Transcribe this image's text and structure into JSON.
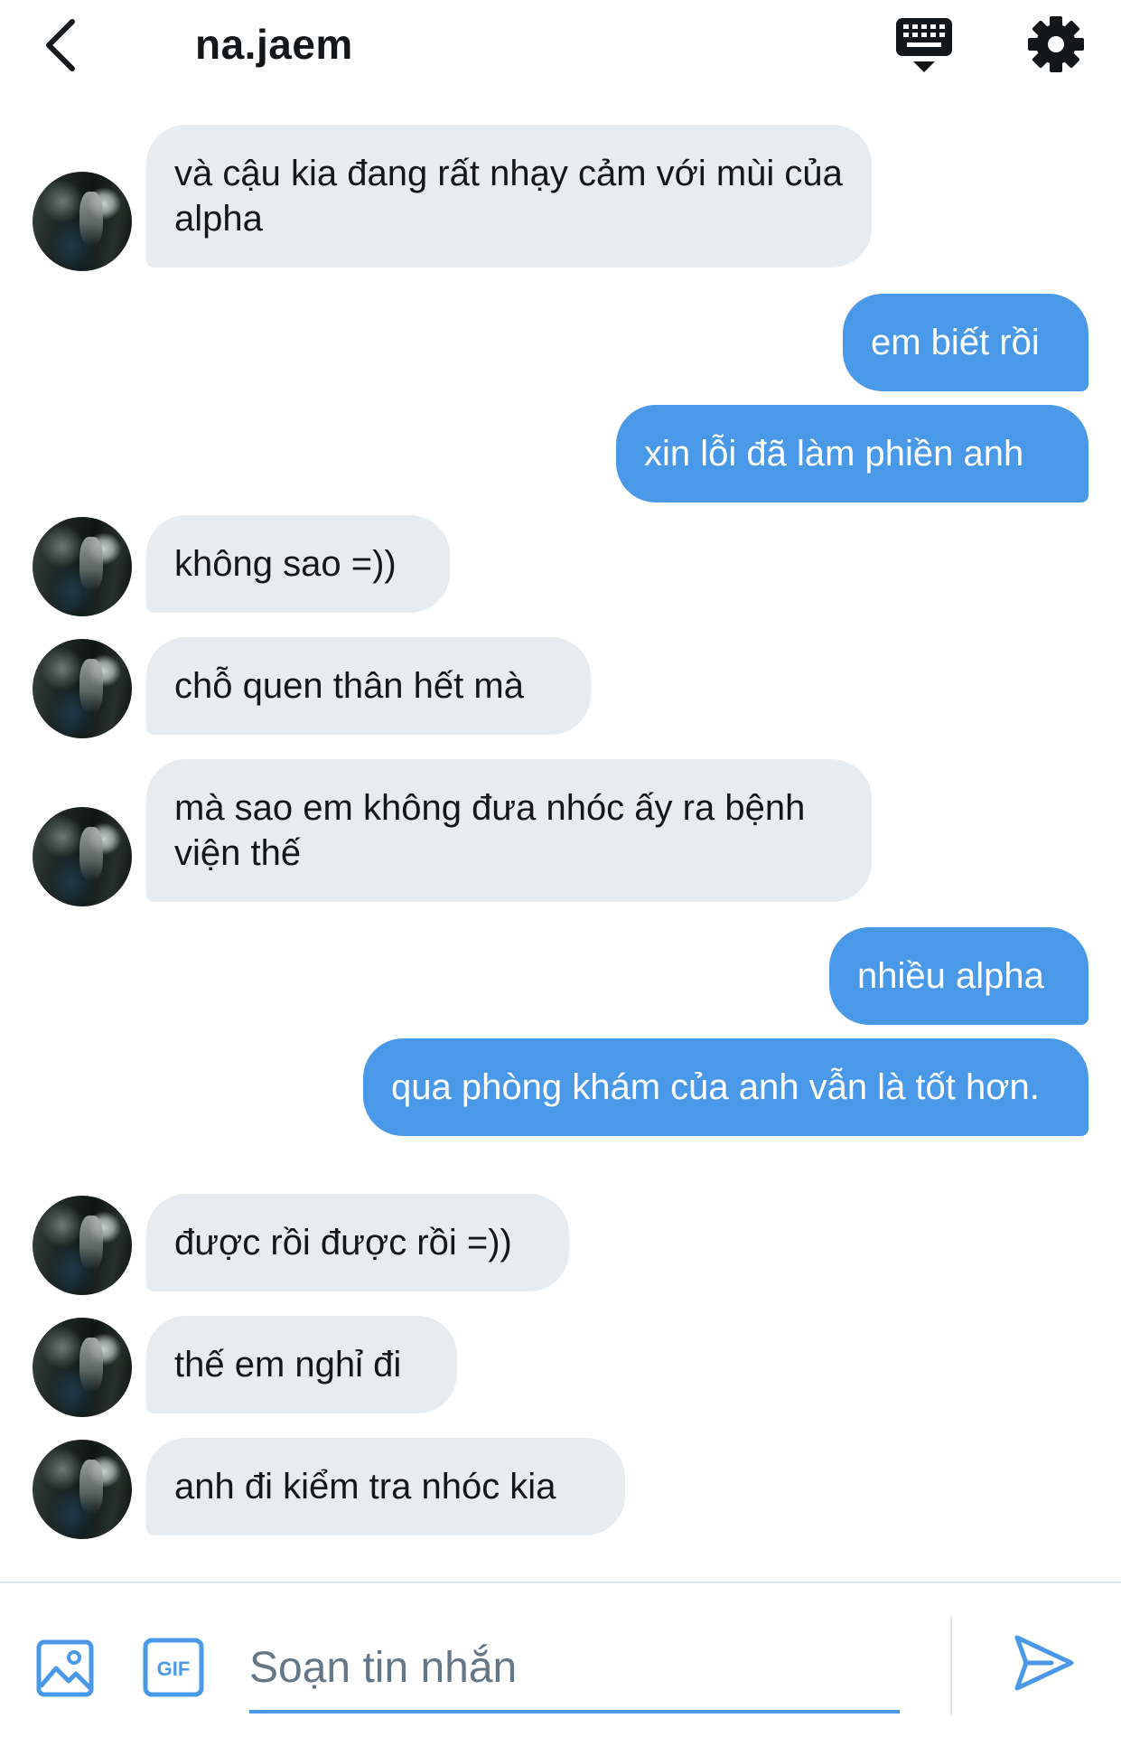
{
  "header": {
    "title": "na.jaem",
    "back_icon": "chevron-left-icon",
    "keyboard_icon": "keyboard-hide-icon",
    "settings_icon": "gear-icon"
  },
  "messages": [
    {
      "direction": "in",
      "text": "và cậu kia đang rất nhạy cảm với mùi của alpha"
    },
    {
      "direction": "out",
      "text": "em biết rồi"
    },
    {
      "direction": "out",
      "text": "xin lỗi đã làm phiền anh"
    },
    {
      "direction": "in",
      "text": "không sao =))"
    },
    {
      "direction": "in",
      "text": "chỗ quen thân hết mà"
    },
    {
      "direction": "in",
      "text": "mà sao em không đưa nhóc ấy ra bệnh viện thế"
    },
    {
      "direction": "out",
      "text": "nhiều alpha"
    },
    {
      "direction": "out",
      "text": "qua phòng khám của anh vẫn là tốt hơn."
    },
    {
      "direction": "in",
      "text": "được rồi được rồi =))"
    },
    {
      "direction": "in",
      "text": "thế em nghỉ đi"
    },
    {
      "direction": "in",
      "text": "anh đi kiểm tra nhóc kia"
    }
  ],
  "composer": {
    "placeholder": "Soạn tin nhắn",
    "value": "",
    "gif_label": "GIF",
    "image_icon": "image-icon",
    "send_icon": "send-icon"
  },
  "colors": {
    "accent": "#4a99e9",
    "incoming_bubble": "#e6ecf0",
    "text": "#14171a",
    "placeholder": "#657786"
  }
}
